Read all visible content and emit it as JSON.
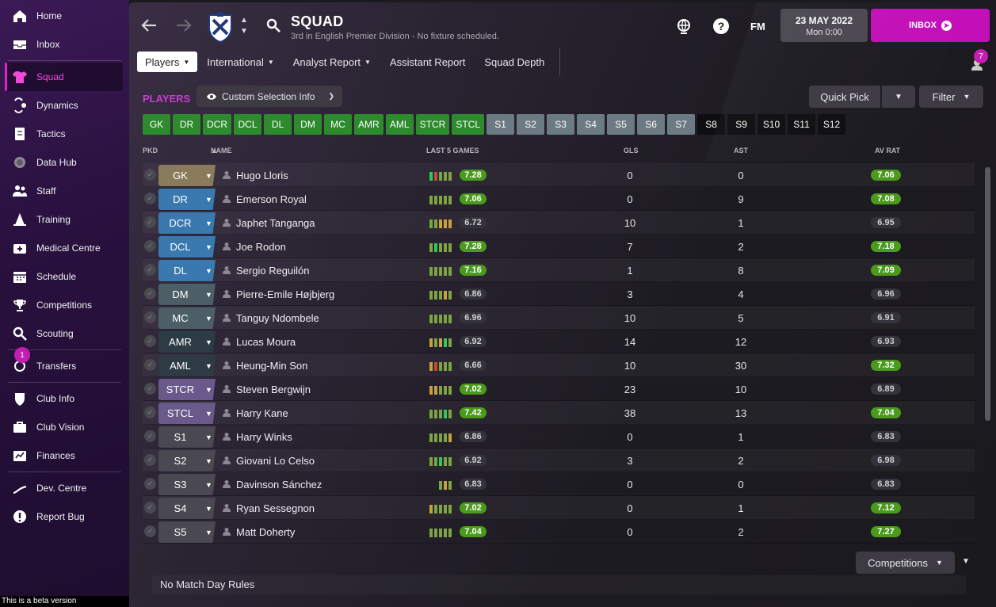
{
  "sidebar": {
    "items": [
      {
        "label": "Home",
        "icon": "home-icon"
      },
      {
        "label": "Inbox",
        "icon": "inbox-icon"
      },
      {
        "label": "Squad",
        "icon": "squad-shirt-icon",
        "active": true
      },
      {
        "label": "Dynamics",
        "icon": "dynamics-icon"
      },
      {
        "label": "Tactics",
        "icon": "tactics-board-icon"
      },
      {
        "label": "Data Hub",
        "icon": "data-hub-icon"
      },
      {
        "label": "Staff",
        "icon": "staff-icon"
      },
      {
        "label": "Training",
        "icon": "training-cone-icon"
      },
      {
        "label": "Medical Centre",
        "icon": "medical-kit-icon"
      },
      {
        "label": "Schedule",
        "icon": "calendar-icon"
      },
      {
        "label": "Competitions",
        "icon": "trophy-icon"
      },
      {
        "label": "Scouting",
        "icon": "magnifier-icon"
      },
      {
        "label": "Transfers",
        "icon": "transfers-icon",
        "badge": "1"
      },
      {
        "label": "Club Info",
        "icon": "shield-icon"
      },
      {
        "label": "Club Vision",
        "icon": "briefcase-icon"
      },
      {
        "label": "Finances",
        "icon": "finances-icon"
      },
      {
        "label": "Dev. Centre",
        "icon": "dev-centre-icon"
      },
      {
        "label": "Report Bug",
        "icon": "report-bug-icon"
      }
    ],
    "beta_text": "This is a beta version"
  },
  "header": {
    "title": "SQUAD",
    "subtitle": "3rd in English Premier Division - No fixture scheduled.",
    "fm_logo": "FM",
    "date": "23 MAY 2022",
    "time": "Mon 0:00",
    "inbox_label": "INBOX",
    "people_badge": "7"
  },
  "tabs": [
    {
      "label": "Players",
      "active": true,
      "dropdown": true
    },
    {
      "label": "International",
      "dropdown": true
    },
    {
      "label": "Analyst Report",
      "dropdown": true
    },
    {
      "label": "Assistant Report",
      "dropdown": false
    },
    {
      "label": "Squad Depth",
      "dropdown": false
    }
  ],
  "section": {
    "heading": "PLAYERS",
    "custom_selection": "Custom Selection Info",
    "quick_pick": "Quick Pick",
    "filter": "Filter"
  },
  "chips": [
    {
      "label": "GK",
      "kind": "g"
    },
    {
      "label": "DR",
      "kind": "g"
    },
    {
      "label": "DCR",
      "kind": "g"
    },
    {
      "label": "DCL",
      "kind": "g"
    },
    {
      "label": "DL",
      "kind": "g"
    },
    {
      "label": "DM",
      "kind": "g"
    },
    {
      "label": "MC",
      "kind": "g"
    },
    {
      "label": "AMR",
      "kind": "g"
    },
    {
      "label": "AML",
      "kind": "g"
    },
    {
      "label": "STCR",
      "kind": "g"
    },
    {
      "label": "STCL",
      "kind": "g"
    },
    {
      "label": "S1",
      "kind": "s"
    },
    {
      "label": "S2",
      "kind": "s"
    },
    {
      "label": "S3",
      "kind": "s"
    },
    {
      "label": "S4",
      "kind": "s"
    },
    {
      "label": "S5",
      "kind": "s"
    },
    {
      "label": "S6",
      "kind": "s"
    },
    {
      "label": "S7",
      "kind": "s"
    },
    {
      "label": "S8",
      "kind": "r"
    },
    {
      "label": "S9",
      "kind": "r"
    },
    {
      "label": "S10",
      "kind": "r"
    },
    {
      "label": "S11",
      "kind": "r"
    },
    {
      "label": "S12",
      "kind": "r"
    }
  ],
  "table": {
    "headers": {
      "pkd": "PKD",
      "name": "NAME",
      "last5": "LAST 5 GAMES",
      "gls": "GLS",
      "ast": "AST",
      "avrat": "AV RAT"
    },
    "rows": [
      {
        "pos": "GK",
        "pos_color": "#8a7b5c",
        "name": "Hugo Lloris",
        "form": [
          "#2ec95a",
          "#c24b3a",
          "#7da342",
          "#7da342",
          "#7da342"
        ],
        "frating": "7.28",
        "fgood": true,
        "gls": "0",
        "ast": "0",
        "avrat": "7.06",
        "agood": true
      },
      {
        "pos": "DR",
        "pos_color": "#3a78b0",
        "name": "Emerson Royal",
        "form": [
          "#7da342",
          "#7da342",
          "#7da342",
          "#7da342",
          "#7da342"
        ],
        "frating": "7.06",
        "fgood": true,
        "gls": "0",
        "ast": "9",
        "avrat": "7.08",
        "agood": true
      },
      {
        "pos": "DCR",
        "pos_color": "#3a78b0",
        "name": "Japhet Tanganga",
        "form": [
          "#7da342",
          "#7da342",
          "#c7a040",
          "#c7a040",
          "#c7a040"
        ],
        "frating": "6.72",
        "fgood": false,
        "gls": "10",
        "ast": "1",
        "avrat": "6.95",
        "agood": false
      },
      {
        "pos": "DCL",
        "pos_color": "#3a78b0",
        "name": "Joe Rodon",
        "form": [
          "#7da342",
          "#2ec95a",
          "#7da342",
          "#7da342",
          "#7da342"
        ],
        "frating": "7.28",
        "fgood": true,
        "gls": "7",
        "ast": "2",
        "avrat": "7.18",
        "agood": true
      },
      {
        "pos": "DL",
        "pos_color": "#3a78b0",
        "name": "Sergio Reguilón",
        "form": [
          "#7da342",
          "#7da342",
          "#7da342",
          "#7da342",
          "#7da342"
        ],
        "frating": "7.16",
        "fgood": true,
        "gls": "1",
        "ast": "8",
        "avrat": "7.09",
        "agood": true
      },
      {
        "pos": "DM",
        "pos_color": "#4c5f66",
        "name": "Pierre-Emile Højbjerg",
        "form": [
          "#7da342",
          "#7da342",
          "#7da342",
          "#c7a040",
          "#7da342"
        ],
        "frating": "6.86",
        "fgood": false,
        "gls": "3",
        "ast": "4",
        "avrat": "6.96",
        "agood": false
      },
      {
        "pos": "MC",
        "pos_color": "#4c5f66",
        "name": "Tanguy Ndombele",
        "form": [
          "#7da342",
          "#7da342",
          "#7da342",
          "#7da342",
          "#7da342"
        ],
        "frating": "6.96",
        "fgood": false,
        "gls": "10",
        "ast": "5",
        "avrat": "6.91",
        "agood": false
      },
      {
        "pos": "AMR",
        "pos_color": "#2d3b45",
        "name": "Lucas Moura",
        "form": [
          "#c7a040",
          "#7da342",
          "#c7a040",
          "#2ec95a",
          "#7da342"
        ],
        "frating": "6.92",
        "fgood": false,
        "gls": "14",
        "ast": "12",
        "avrat": "6.93",
        "agood": false
      },
      {
        "pos": "AML",
        "pos_color": "#2d3b45",
        "name": "Heung-Min Son",
        "form": [
          "#c7a040",
          "#c24b3a",
          "#7da342",
          "#7da342",
          "#7da342"
        ],
        "frating": "6.66",
        "fgood": false,
        "gls": "10",
        "ast": "30",
        "avrat": "7.32",
        "agood": true
      },
      {
        "pos": "STCR",
        "pos_color": "#6a5a8c",
        "name": "Steven Bergwijn",
        "form": [
          "#c7a040",
          "#c7a040",
          "#7da342",
          "#7da342",
          "#7da342"
        ],
        "frating": "7.02",
        "fgood": true,
        "gls": "23",
        "ast": "10",
        "avrat": "6.89",
        "agood": false
      },
      {
        "pos": "STCL",
        "pos_color": "#6a5a8c",
        "name": "Harry Kane",
        "form": [
          "#7da342",
          "#7da342",
          "#7da342",
          "#2ec95a",
          "#7da342"
        ],
        "frating": "7.42",
        "fgood": true,
        "gls": "38",
        "ast": "13",
        "avrat": "7.04",
        "agood": true
      },
      {
        "pos": "S1",
        "pos_color": "#4a4850",
        "name": "Harry Winks",
        "form": [
          "#7da342",
          "#7da342",
          "#7da342",
          "#7da342",
          "#c7a040"
        ],
        "frating": "6.86",
        "fgood": false,
        "gls": "0",
        "ast": "1",
        "avrat": "6.83",
        "agood": false
      },
      {
        "pos": "S2",
        "pos_color": "#4a4850",
        "name": "Giovani Lo Celso",
        "form": [
          "#7da342",
          "#7da342",
          "#2ec95a",
          "#7da342",
          "#7da342"
        ],
        "frating": "6.92",
        "fgood": false,
        "gls": "3",
        "ast": "2",
        "avrat": "6.98",
        "agood": false
      },
      {
        "pos": "S3",
        "pos_color": "#4a4850",
        "name": "Davinson Sánchez",
        "form": [
          "",
          "",
          "#7da342",
          "#c7a040",
          "#7da342"
        ],
        "frating": "6.83",
        "fgood": false,
        "gls": "0",
        "ast": "0",
        "avrat": "6.83",
        "agood": false
      },
      {
        "pos": "S4",
        "pos_color": "#4a4850",
        "name": "Ryan Sessegnon",
        "form": [
          "#c7a040",
          "#7da342",
          "#7da342",
          "#7da342",
          "#7da342"
        ],
        "frating": "7.02",
        "fgood": true,
        "gls": "0",
        "ast": "1",
        "avrat": "7.12",
        "agood": true
      },
      {
        "pos": "S5",
        "pos_color": "#4a4850",
        "name": "Matt Doherty",
        "form": [
          "#7da342",
          "#7da342",
          "#7da342",
          "#7da342",
          "#7da342"
        ],
        "frating": "7.04",
        "fgood": true,
        "gls": "0",
        "ast": "2",
        "avrat": "7.27",
        "agood": true
      }
    ]
  },
  "footer": {
    "competitions": "Competitions",
    "match_rules": "No Match Day Rules"
  }
}
